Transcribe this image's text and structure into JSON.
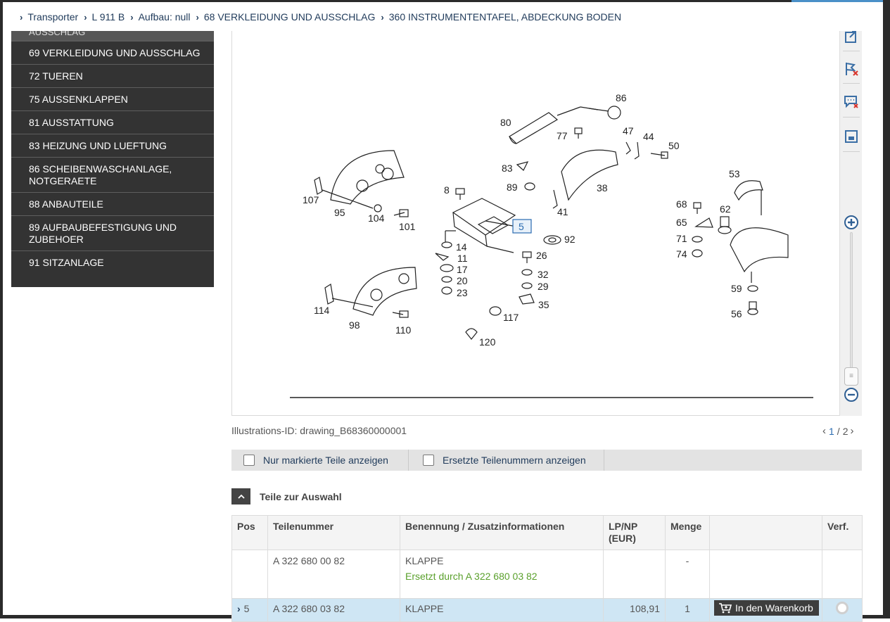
{
  "breadcrumb": [
    {
      "label": "Transporter"
    },
    {
      "label": "L 911 B"
    },
    {
      "label": "Aufbau: null"
    },
    {
      "label": "68 VERKLEIDUNG UND AUSSCHLAG"
    },
    {
      "label": "360 INSTRUMENTENTAFEL, ABDECKUNG BODEN"
    }
  ],
  "sidebar": {
    "clipped_item": "AUSSCHLAG",
    "items": [
      {
        "label": "69 VERKLEIDUNG UND AUSSCHLAG"
      },
      {
        "label": "72 TUEREN"
      },
      {
        "label": "75 AUSSENKLAPPEN"
      },
      {
        "label": "81 AUSSTATTUNG"
      },
      {
        "label": "83 HEIZUNG UND LUEFTUNG"
      },
      {
        "label": "86 SCHEIBENWASCHANLAGE, NOTGERAETE"
      },
      {
        "label": "88 ANBAUTEILE"
      },
      {
        "label": "89 AUFBAUBEFESTIGUNG UND ZUBEHOER"
      },
      {
        "label": "91 SITZANLAGE"
      }
    ]
  },
  "drawing": {
    "selected_callout": "5",
    "callouts": [
      "86",
      "80",
      "77",
      "47",
      "44",
      "50",
      "83",
      "89",
      "38",
      "8",
      "41",
      "53",
      "68",
      "62",
      "65",
      "107",
      "95",
      "104",
      "101",
      "92",
      "71",
      "74",
      "14",
      "11",
      "26",
      "32",
      "17",
      "20",
      "29",
      "23",
      "35",
      "59",
      "114",
      "98",
      "110",
      "117",
      "56",
      "120"
    ]
  },
  "toolbar": {
    "icons": [
      "open-external-icon",
      "flag-remove-icon",
      "comment-remove-icon",
      "window-icon",
      "zoom-in-icon",
      "zoom-out-icon"
    ]
  },
  "illustration": {
    "id_text": "Illustrations-ID: drawing_B68360000001",
    "page_current": "1",
    "page_separator": "/",
    "page_total": "2"
  },
  "filters": [
    {
      "label": "Nur markierte Teile anzeigen"
    },
    {
      "label": "Ersetzte Teilenummern anzeigen"
    }
  ],
  "section": {
    "title": "Teile zur Auswahl"
  },
  "table": {
    "headers": {
      "pos": "Pos",
      "partnumber": "Teilenummer",
      "name": "Benennung / Zusatzinformationen",
      "price": "LP/NP (EUR)",
      "qty": "Menge",
      "action": "",
      "verf": "Verf."
    },
    "rows": [
      {
        "pos": "",
        "partnumber": "A 322 680 00 82",
        "name": "KLAPPE",
        "info": "Ersetzt durch A 322 680 03 82",
        "price": "",
        "qty": "-"
      },
      {
        "pos": "5",
        "partnumber": "A 322 680 03 82",
        "name": "KLAPPE",
        "info": "",
        "price": "108,91",
        "qty": "1",
        "cart_label": "In den Warenkorb"
      }
    ]
  },
  "colors": {
    "sidebar_bg": "#333333",
    "link": "#1f3a5a",
    "replaced": "#5aa02c",
    "selected_row": "#cfe6f4",
    "callout_highlight": "#2a6bb0"
  }
}
